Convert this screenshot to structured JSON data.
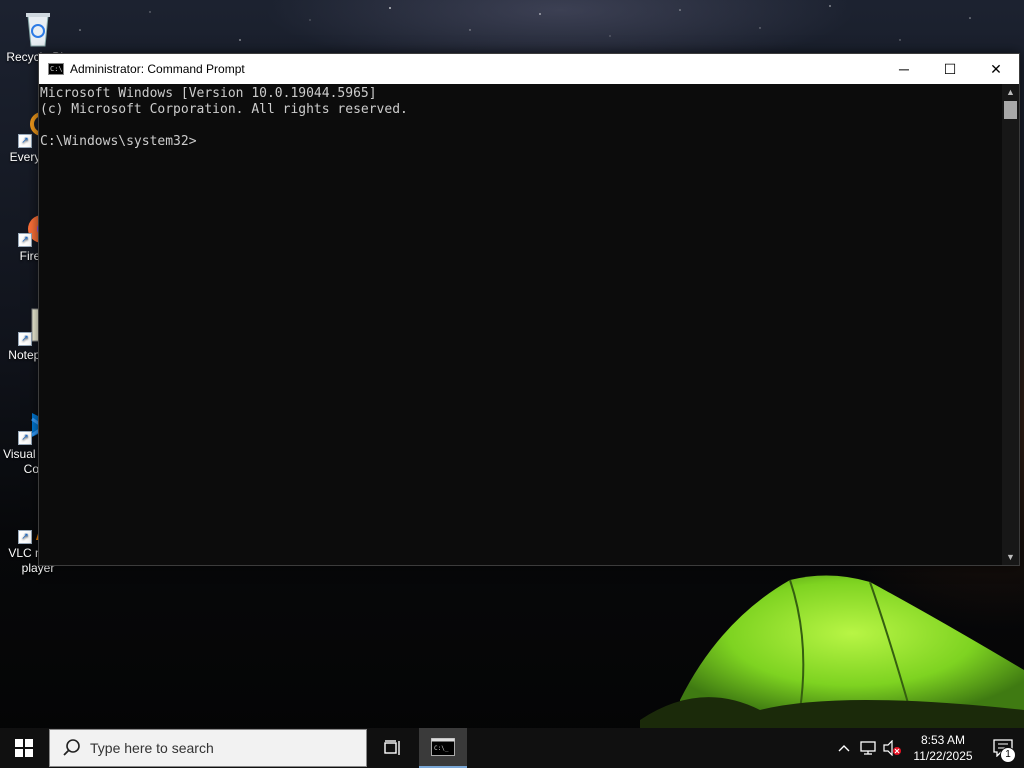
{
  "desktop": {
    "icons": [
      {
        "label": "Recycle Bin",
        "icon": "recycle-bin-icon"
      },
      {
        "label": "Everything",
        "icon": "everything-icon"
      },
      {
        "label": "Firefox",
        "icon": "firefox-icon"
      },
      {
        "label": "Notepad++",
        "icon": "notepad-plus-plus-icon"
      },
      {
        "label": "Visual Studio Code",
        "icon": "vscode-icon"
      },
      {
        "label": "VLC media player",
        "icon": "vlc-icon"
      }
    ]
  },
  "window": {
    "title": "Administrator: Command Prompt",
    "icon": "cmd-icon",
    "controls": {
      "minimize": "─",
      "maximize": "☐",
      "close": "✕"
    },
    "console_lines": [
      "Microsoft Windows [Version 10.0.19044.5965]",
      "(c) Microsoft Corporation. All rights reserved.",
      "",
      "C:\\Windows\\system32>"
    ]
  },
  "taskbar": {
    "start_icon": "windows-logo-icon",
    "search_placeholder": "Type here to search",
    "task_view_icon": "task-view-icon",
    "pinned": [
      {
        "name": "Command Prompt",
        "icon": "cmd-icon",
        "active": true
      }
    ],
    "tray": {
      "time": "8:53 AM",
      "date": "11/22/2025",
      "notification_count": "1"
    }
  },
  "colors": {
    "console_bg": "#0c0c0c",
    "console_text": "#cccccc",
    "taskbar_bg": "#101010",
    "tent_green": "#7ed321"
  }
}
